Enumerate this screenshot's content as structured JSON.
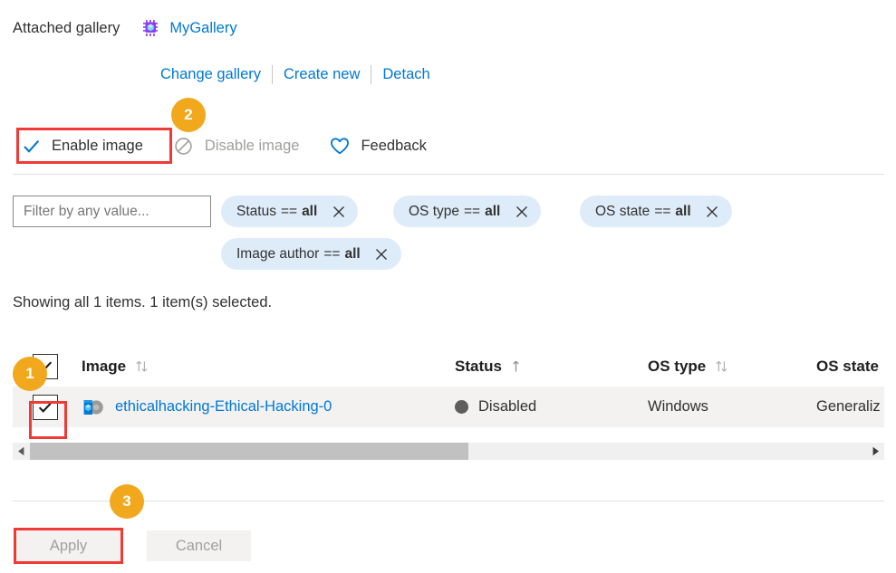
{
  "gallery": {
    "label": "Attached gallery",
    "icon": "gallery-chip-icon",
    "name": "MyGallery",
    "actions": [
      {
        "label": "Change gallery"
      },
      {
        "label": "Create new"
      },
      {
        "label": "Detach"
      }
    ]
  },
  "command_bar": {
    "buttons": [
      {
        "label": "Enable image",
        "icon": "checkmark-icon",
        "enabled": true
      },
      {
        "label": "Disable image",
        "icon": "block-circle-icon",
        "enabled": false
      },
      {
        "label": "Feedback",
        "icon": "heart-icon",
        "enabled": true
      }
    ]
  },
  "callouts": [
    {
      "number": "1"
    },
    {
      "number": "2"
    },
    {
      "number": "3"
    }
  ],
  "filter": {
    "placeholder": "Filter by any value...",
    "value": "",
    "pills": [
      {
        "field": "Status",
        "op": "==",
        "value": "all",
        "remove_icon": "close-icon"
      },
      {
        "field": "OS type",
        "op": "==",
        "value": "all",
        "remove_icon": "close-icon"
      },
      {
        "field": "OS state",
        "op": "==",
        "value": "all",
        "remove_icon": "close-icon"
      },
      {
        "field": "Image author",
        "op": "==",
        "value": "all",
        "remove_icon": "close-icon"
      }
    ]
  },
  "status_line": "Showing all 1 items.  1 item(s) selected.",
  "table": {
    "header": {
      "select_all_checked": true,
      "columns": [
        {
          "label": "Image",
          "sort": "sort-both-icon"
        },
        {
          "label": "Status",
          "sort": "sort-asc-icon"
        },
        {
          "label": "OS type",
          "sort": "sort-both-icon"
        },
        {
          "label": "OS state",
          "sort": ""
        }
      ]
    },
    "rows": [
      {
        "checked": true,
        "icon": "vm-image-icon",
        "name": "ethicalhacking-Ethical-Hacking-0",
        "status": "Disabled",
        "status_dot_color": "#605e5c",
        "os_type": "Windows",
        "os_state": "Generaliz"
      }
    ]
  },
  "scrollbar": {
    "left_icon": "triangle-left-icon",
    "right_icon": "triangle-right-icon"
  },
  "footer": {
    "apply_label": "Apply",
    "cancel_label": "Cancel"
  },
  "colors": {
    "link": "#0078d4",
    "badge": "#f2a81d",
    "highlight": "#f03a36",
    "pill_bg": "#deecf9",
    "row_bg": "#f3f2f1"
  }
}
